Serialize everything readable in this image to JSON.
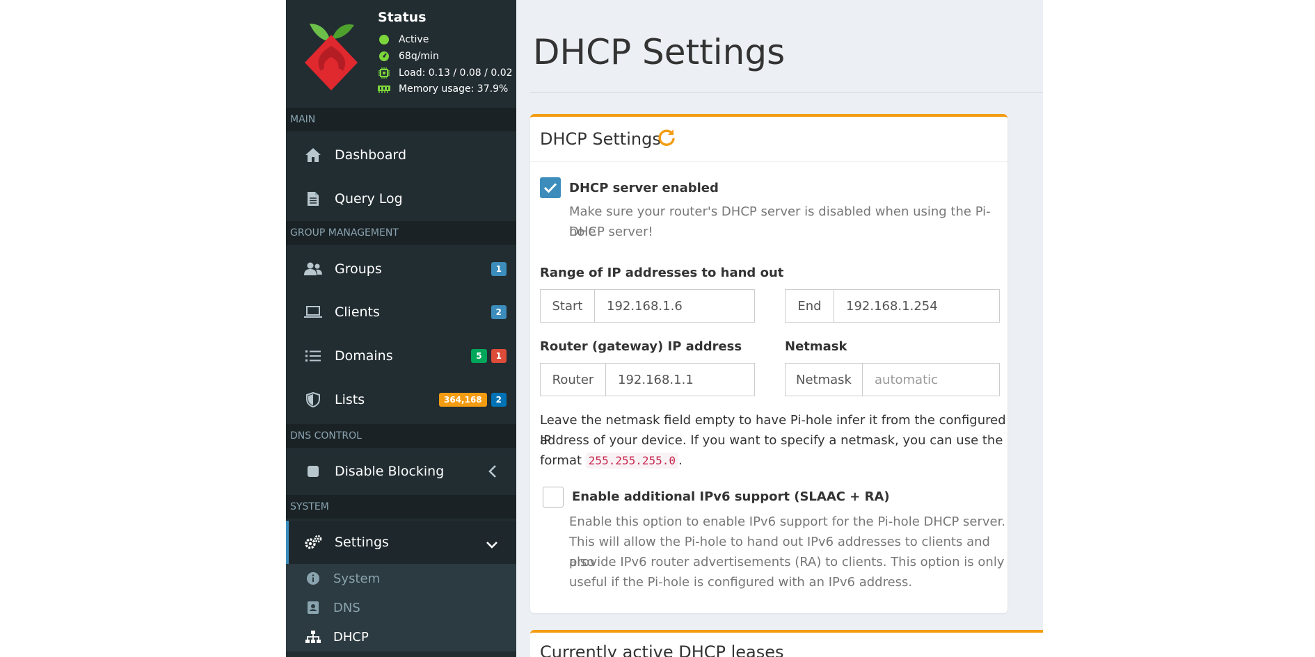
{
  "status": {
    "title": "Status",
    "active": "Active",
    "queries": "68q/min",
    "load": "Load: 0.13 / 0.08 / 0.02",
    "memory": "Memory usage: 37.9%"
  },
  "sidebar": {
    "sections": {
      "main": "MAIN",
      "group": "GROUP MANAGEMENT",
      "dns": "DNS CONTROL",
      "system": "SYSTEM"
    },
    "items": {
      "dashboard": "Dashboard",
      "querylog": "Query Log",
      "groups": "Groups",
      "clients": "Clients",
      "domains": "Domains",
      "lists": "Lists",
      "disable": "Disable Blocking",
      "settings": "Settings",
      "system": "System",
      "dns": "DNS",
      "dhcp": "DHCP"
    },
    "badges": {
      "groups": "1",
      "clients": "2",
      "domains_allow": "5",
      "domains_deny": "1",
      "lists_domains": "364,168",
      "lists_count": "2"
    }
  },
  "page": {
    "title": "DHCP Settings"
  },
  "dhcp": {
    "card_title": "DHCP Settings",
    "enabled_label": "DHCP server enabled",
    "enabled_help_1": "Make sure your router's DHCP server is disabled when using the Pi-hole",
    "enabled_help_2": "DHCP server!",
    "range_label": "Range of IP addresses to hand out",
    "start_addon": "Start",
    "start_value": "192.168.1.6",
    "end_addon": "End",
    "end_value": "192.168.1.254",
    "router_label": "Router (gateway) IP address",
    "router_addon": "Router",
    "router_value": "192.168.1.1",
    "netmask_label": "Netmask",
    "netmask_addon": "Netmask",
    "netmask_placeholder": "automatic",
    "netmask_help_1": "Leave the netmask field empty to have Pi-hole infer it from the configured IP",
    "netmask_help_2": "address of your device. If you want to specify a netmask, you can use the",
    "netmask_help_3a": "format",
    "netmask_help_code": "255.255.255.0",
    "netmask_help_3b": ".",
    "ipv6_label": "Enable additional IPv6 support (SLAAC + RA)",
    "ipv6_help_1": "Enable this option to enable IPv6 support for the Pi-hole DHCP server.",
    "ipv6_help_2": "This will allow the Pi-hole to hand out IPv6 addresses to clients and also",
    "ipv6_help_3": "provide IPv6 router advertisements (RA) to clients. This option is only",
    "ipv6_help_4": "useful if the Pi-hole is configured with an IPv6 address."
  },
  "leases": {
    "title": "Currently active DHCP leases"
  },
  "colors": {
    "sidebar_bg": "#222d32",
    "accent_blue": "#3c8dbc",
    "card_orange": "#f39c12",
    "badge_blue": "#3c8dbc",
    "badge_green": "#00a65a",
    "badge_red": "#dd4b39",
    "badge_yellow": "#f39c12",
    "status_green": "#7cd63b"
  }
}
